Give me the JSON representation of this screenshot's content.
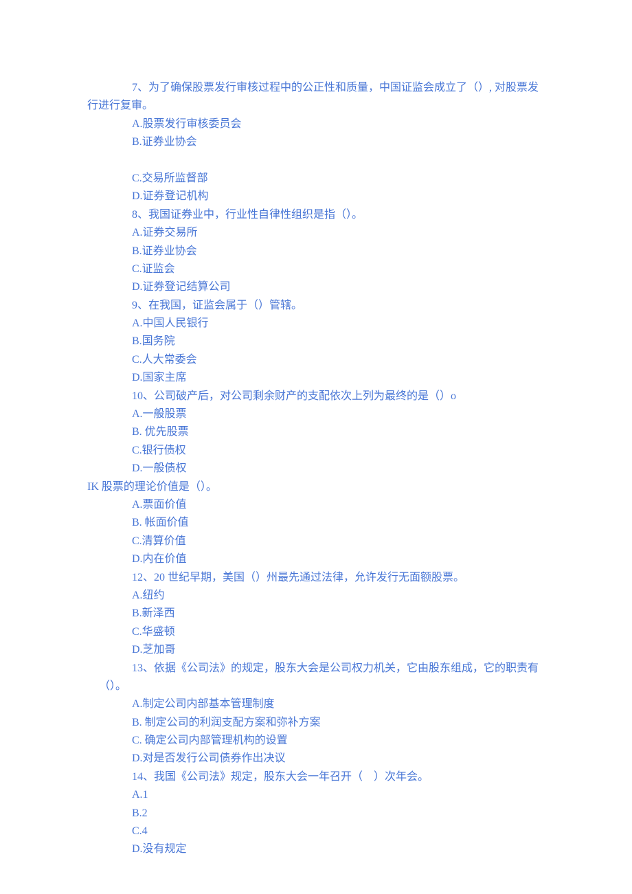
{
  "lines": [
    {
      "text": "7、为了确保股票发行审核过程中的公正性和质量，中国证监会成立了（）, 对股票发",
      "class": ""
    },
    {
      "text": "行进行复审。",
      "class": "outdent"
    },
    {
      "text": "A.股票发行审核委员会",
      "class": ""
    },
    {
      "text": "B.证券业协会",
      "class": ""
    },
    {
      "text": " ",
      "class": ""
    },
    {
      "text": "C.交易所监督部",
      "class": ""
    },
    {
      "text": "D.证券登记机构",
      "class": ""
    },
    {
      "text": "8、我国证券业中，行业性自律性组织是指（）。",
      "class": ""
    },
    {
      "text": "A.证券交易所",
      "class": ""
    },
    {
      "text": "B.证券业协会",
      "class": ""
    },
    {
      "text": "C.证监会",
      "class": ""
    },
    {
      "text": "D.证券登记结算公司",
      "class": ""
    },
    {
      "text": "9、在我国，证监会属于（）管辖。",
      "class": ""
    },
    {
      "text": "A.中国人民银行",
      "class": ""
    },
    {
      "text": "B.国务院",
      "class": ""
    },
    {
      "text": "C.人大常委会",
      "class": ""
    },
    {
      "text": "D.国家主席",
      "class": ""
    },
    {
      "text": "10、公司破产后，对公司剩余财产的支配依次上列为最终的是（）o",
      "class": ""
    },
    {
      "text": "A.一般股票",
      "class": ""
    },
    {
      "text": "B. 优先股票",
      "class": ""
    },
    {
      "text": "C.银行债权",
      "class": ""
    },
    {
      "text": "D.一般债权",
      "class": ""
    },
    {
      "text": "IK 股票的理论价值是（）。",
      "class": "outdent"
    },
    {
      "text": "A.票面价值",
      "class": ""
    },
    {
      "text": "B. 帐面价值",
      "class": ""
    },
    {
      "text": "C.清算价值",
      "class": ""
    },
    {
      "text": "D.内在价值",
      "class": ""
    },
    {
      "text": "12、20 世纪早期，美国（）州最先通过法律，允许发行无面额股票。",
      "class": ""
    },
    {
      "text": "A.纽约",
      "class": ""
    },
    {
      "text": "B.新泽西",
      "class": ""
    },
    {
      "text": "C.华盛顿",
      "class": ""
    },
    {
      "text": "D.芝加哥",
      "class": ""
    },
    {
      "text": "13、依据《公司法》的规定，股东大会是公司权力机关，它由股东组成，它的职责有",
      "class": ""
    },
    {
      "text": "（）。",
      "class": "outdent-partial"
    },
    {
      "text": "A.制定公司内部基本管理制度",
      "class": ""
    },
    {
      "text": "B. 制定公司的利润支配方案和弥补方案",
      "class": ""
    },
    {
      "text": "C. 确定公司内部管理机构的设置",
      "class": ""
    },
    {
      "text": "D.对是否发行公司债券作出决议",
      "class": ""
    },
    {
      "text": "14、我国《公司法》规定，股东大会一年召开（    ）次年会。",
      "class": ""
    },
    {
      "text": "A.1",
      "class": ""
    },
    {
      "text": "B.2",
      "class": ""
    },
    {
      "text": "C.4",
      "class": ""
    },
    {
      "text": "D.没有规定",
      "class": ""
    }
  ]
}
